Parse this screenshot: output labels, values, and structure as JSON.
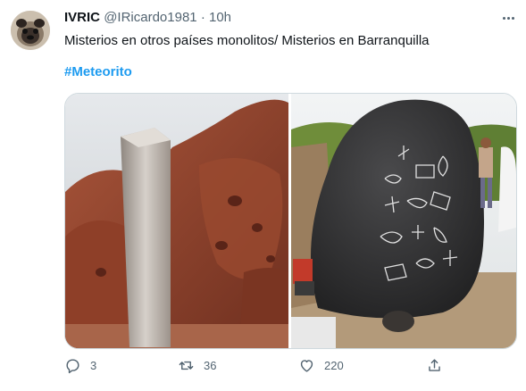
{
  "tweet": {
    "display_name": "IVRIC",
    "handle": "@IRicardo1981",
    "separator": "·",
    "time": "10h",
    "text": "Misterios en otros países monolitos/ Misterios en Barranquilla",
    "hashtag": "#Meteorito"
  },
  "actions": {
    "reply_count": "3",
    "retweet_count": "36",
    "like_count": "220"
  },
  "icons": {
    "more": "more-horizontal-icon",
    "reply": "reply-icon",
    "retweet": "retweet-icon",
    "like": "heart-icon",
    "share": "share-icon"
  },
  "colors": {
    "link": "#1d9bf0",
    "secondary_text": "#536471",
    "border": "#cfd9de"
  }
}
